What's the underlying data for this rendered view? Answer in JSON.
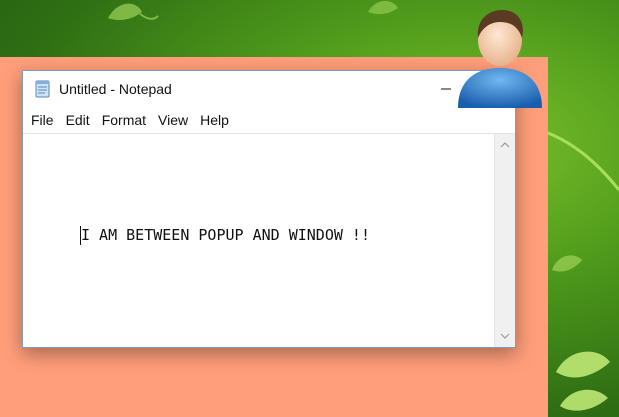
{
  "window": {
    "title": "Untitled - Notepad",
    "controls": {
      "minimize_icon": "minimize-icon",
      "maximize_icon": "maximize-icon"
    }
  },
  "menu": {
    "items": [
      "File",
      "Edit",
      "Format",
      "View",
      "Help"
    ]
  },
  "editor": {
    "content": "I AM BETWEEN POPUP AND WINDOW !!"
  },
  "icons": {
    "app": "notepad-icon",
    "user": "user-avatar-icon",
    "scroll_up": "chevron-up-icon",
    "scroll_down": "chevron-down-icon"
  },
  "colors": {
    "popup_bg": "#ff9e7a",
    "desktop_green": "#2f6e14",
    "window_border": "#7a9cc6"
  }
}
